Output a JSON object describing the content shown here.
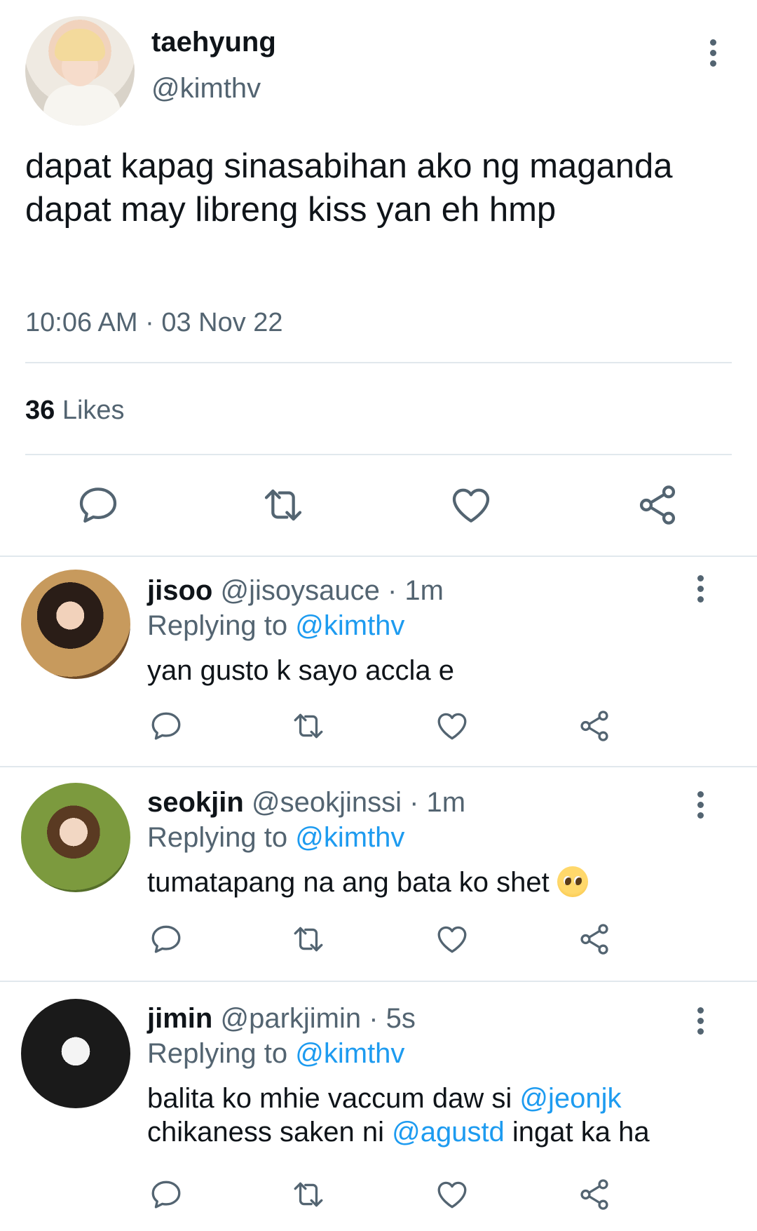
{
  "tweet": {
    "display_name": "taehyung",
    "handle": "@kimthv",
    "text": "dapat kapag sinasabihan ako ng maganda dapat may libreng kiss yan eh hmp",
    "timestamp": "10:06 AM · 03 Nov 22",
    "likes_count": "36",
    "likes_label": "Likes"
  },
  "replies": [
    {
      "display_name": "jisoo",
      "handle": "@jisoysauce",
      "time": "· 1m",
      "replying_label": "Replying to",
      "replying_to": "@kimthv",
      "text": "yan gusto k sayo accla e"
    },
    {
      "display_name": "seokjin",
      "handle": "@seokjinssi",
      "time": "· 1m",
      "replying_label": "Replying to",
      "replying_to": "@kimthv",
      "text": "tumatapang na ang bata ko shet",
      "emoji": "pleading-face"
    },
    {
      "display_name": "jimin",
      "handle": "@parkjimin",
      "time": "· 5s",
      "replying_label": "Replying to",
      "replying_to": "@kimthv",
      "text_part1": "balita ko mhie vaccum daw si",
      "mention1": "@jeonjk",
      "text_part2": "chikaness saken ni",
      "mention2": "@agustd",
      "text_part3": "ingat ka ha"
    }
  ],
  "icons": {
    "reply": "speech-bubble-icon",
    "retweet": "retweet-icon",
    "like": "heart-icon",
    "share": "share-icon",
    "more": "vertical-dots-icon"
  },
  "colors": {
    "text": "#0f1419",
    "secondary": "#536471",
    "mention": "#1d9bf0",
    "divider": "#e1e8ed"
  }
}
